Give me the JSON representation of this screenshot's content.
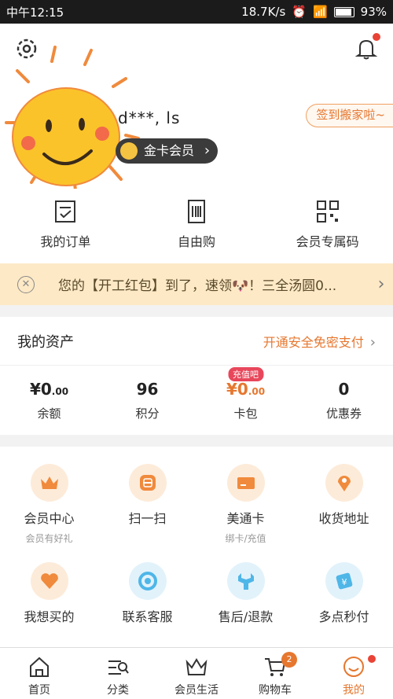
{
  "status_bar": {
    "time": "中午12:15",
    "network_speed": "18.7K/s",
    "battery": "93%"
  },
  "header": {
    "username": "d***, ls",
    "vip_label": "金卡会员",
    "signin_label": "签到搬家啦~"
  },
  "quick_actions": [
    {
      "label": "我的订单",
      "icon": "order-icon"
    },
    {
      "label": "自由购",
      "icon": "barcode-icon"
    },
    {
      "label": "会员专属码",
      "icon": "qrcode-icon"
    }
  ],
  "banner": {
    "text": "您的【开工红包】到了，速领🐶！三全汤圆0..."
  },
  "assets": {
    "title": "我的资产",
    "link": "开通安全免密支付",
    "items": [
      {
        "value_main": "¥0",
        "value_dec": ".00",
        "label": "余额"
      },
      {
        "value_main": "96",
        "value_dec": "",
        "label": "积分"
      },
      {
        "value_main": "¥0",
        "value_dec": ".00",
        "label": "卡包",
        "tag": "充值吧"
      },
      {
        "value_main": "0",
        "value_dec": "",
        "label": "优惠券"
      }
    ]
  },
  "services": [
    {
      "name": "会员中心",
      "sub": "会员有好礼",
      "icon": "crown-icon",
      "color": "#f08a3c"
    },
    {
      "name": "扫一扫",
      "sub": "",
      "icon": "scan-icon",
      "color": "#f08a3c"
    },
    {
      "name": "美通卡",
      "sub": "绑卡/充值",
      "icon": "card-icon",
      "color": "#f08a3c"
    },
    {
      "name": "收货地址",
      "sub": "",
      "icon": "location-icon",
      "color": "#f08a3c"
    },
    {
      "name": "我想买的",
      "sub": "",
      "icon": "heart-icon",
      "color": "#f08a3c"
    },
    {
      "name": "联系客服",
      "sub": "",
      "icon": "service-icon",
      "color": "#4fb6e8"
    },
    {
      "name": "售后/退款",
      "sub": "",
      "icon": "wrench-icon",
      "color": "#4fb6e8"
    },
    {
      "name": "多点秒付",
      "sub": "",
      "icon": "pay-icon",
      "color": "#4fb6e8"
    }
  ],
  "tabbar": [
    {
      "label": "首页",
      "icon": "home-icon"
    },
    {
      "label": "分类",
      "icon": "category-icon"
    },
    {
      "label": "会员生活",
      "icon": "crown-tab-icon"
    },
    {
      "label": "购物车",
      "icon": "cart-icon",
      "badge": "2"
    },
    {
      "label": "我的",
      "icon": "profile-icon",
      "active": true
    }
  ]
}
